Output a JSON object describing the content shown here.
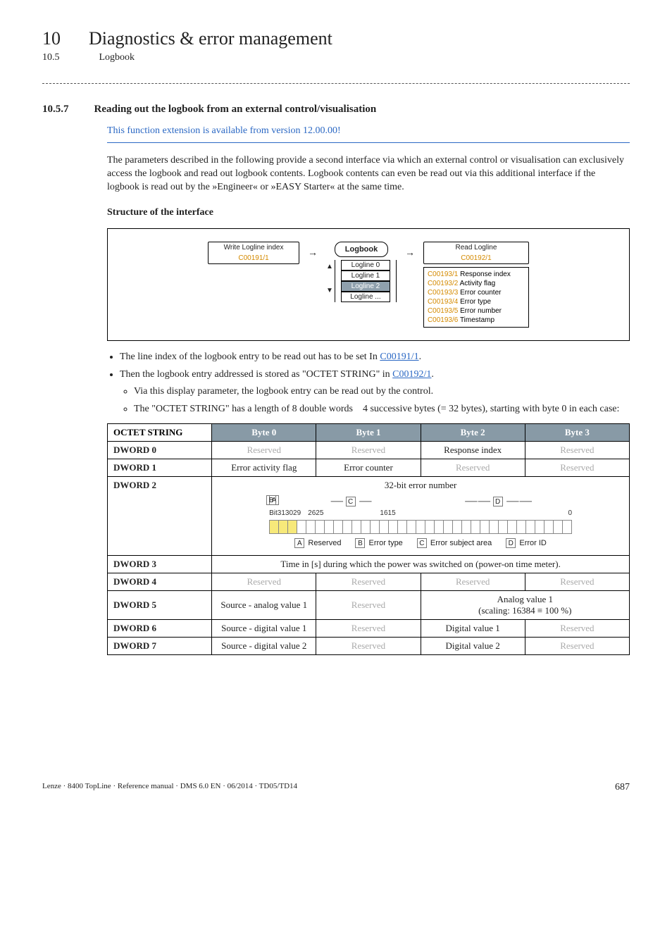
{
  "header": {
    "chapterNum": "10",
    "chapterTitle": "Diagnostics & error management",
    "subNum": "10.5",
    "subTitle": "Logbook"
  },
  "section": {
    "num": "10.5.7",
    "title": "Reading out the logbook from an external control/visualisation",
    "blueNote": "This function extension is available from version 12.00.00!",
    "para1": "The parameters described in the following provide a second interface via which an external control or visualisation can exclusively access the logbook and read out logbook contents. Logbook contents can even be read out via this additional interface if the logbook is read out by the »Engineer« or »EASY Starter« at the same time.",
    "subheading": "Structure of the interface"
  },
  "diagram": {
    "writeTop": "Write Logline index",
    "writeBot": "C00191/1",
    "logbookLabel": "Logbook",
    "loglines": [
      "Logline 0",
      "Logline 1",
      "Logline 2",
      "Logline ..."
    ],
    "readTop": "Read Logline",
    "readBot": "C00192/1",
    "readParams": [
      {
        "code": "C00193/1",
        "desc": "Response index"
      },
      {
        "code": "C00193/2",
        "desc": "Activity flag"
      },
      {
        "code": "C00193/3",
        "desc": "Error counter"
      },
      {
        "code": "C00193/4",
        "desc": "Error type"
      },
      {
        "code": "C00193/5",
        "desc": "Error number"
      },
      {
        "code": "C00193/6",
        "desc": "Timestamp"
      }
    ]
  },
  "bullets": {
    "b1a": "The line index of the logbook entry to be read out has to be set In ",
    "b1link": "C00191/1",
    "b1b": ".",
    "b2a": "Then the logbook entry addressed is stored as \"OCTET STRING\" in ",
    "b2link": "C00192/1",
    "b2b": ".",
    "b2s1": "Via this display parameter, the logbook entry can be read out by the control.",
    "b2s2": "The \"OCTET STRING\" has a length of 8 double words    4 successive bytes (= 32 bytes), starting with byte 0 in each case:"
  },
  "table": {
    "headers": [
      "OCTET STRING",
      "Byte 0",
      "Byte 1",
      "Byte 2",
      "Byte 3"
    ],
    "dword0": {
      "label": "DWORD 0",
      "c0": "Reserved",
      "c1": "Reserved",
      "c2": "Response index",
      "c3": "Reserved"
    },
    "dword1": {
      "label": "DWORD 1",
      "c0": "Error activity flag",
      "c1": "Error counter",
      "c2": "Reserved",
      "c3": "Reserved"
    },
    "dword2": {
      "label": "DWORD 2",
      "title": "32-bit error number",
      "letters": {
        "A": "A",
        "B": "B",
        "C": "C",
        "D": "D"
      },
      "bitAxis": {
        "l0": "Bit31",
        "l1": "30",
        "l2": "29",
        "l3": "26",
        "l4": "25",
        "l5": "16",
        "l6": "15",
        "l7": "0"
      },
      "legend": {
        "A": " Reserved",
        "B": " Error type",
        "C": " Error subject area",
        "D": " Error ID"
      }
    },
    "dword3": {
      "label": "DWORD 3",
      "span": "Time in [s] during which the power was switched on (power-on time meter)."
    },
    "dword4": {
      "label": "DWORD 4",
      "c0": "Reserved",
      "c1": "Reserved",
      "c2": "Reserved",
      "c3": "Reserved"
    },
    "dword5": {
      "label": "DWORD 5",
      "c0": "Source - analog value 1",
      "c1": "Reserved",
      "c23": "Analog value 1\n(scaling: 16384 ≡ 100 %)"
    },
    "dword6": {
      "label": "DWORD 6",
      "c0": "Source - digital value 1",
      "c1": "Reserved",
      "c2": "Digital value 1",
      "c3": "Reserved"
    },
    "dword7": {
      "label": "DWORD 7",
      "c0": "Source - digital value 2",
      "c1": "Reserved",
      "c2": "Digital value 2",
      "c3": "Reserved"
    }
  },
  "footer": {
    "left": "Lenze · 8400 TopLine · Reference manual · DMS 6.0 EN · 06/2014 · TD05/TD14",
    "page": "687"
  }
}
